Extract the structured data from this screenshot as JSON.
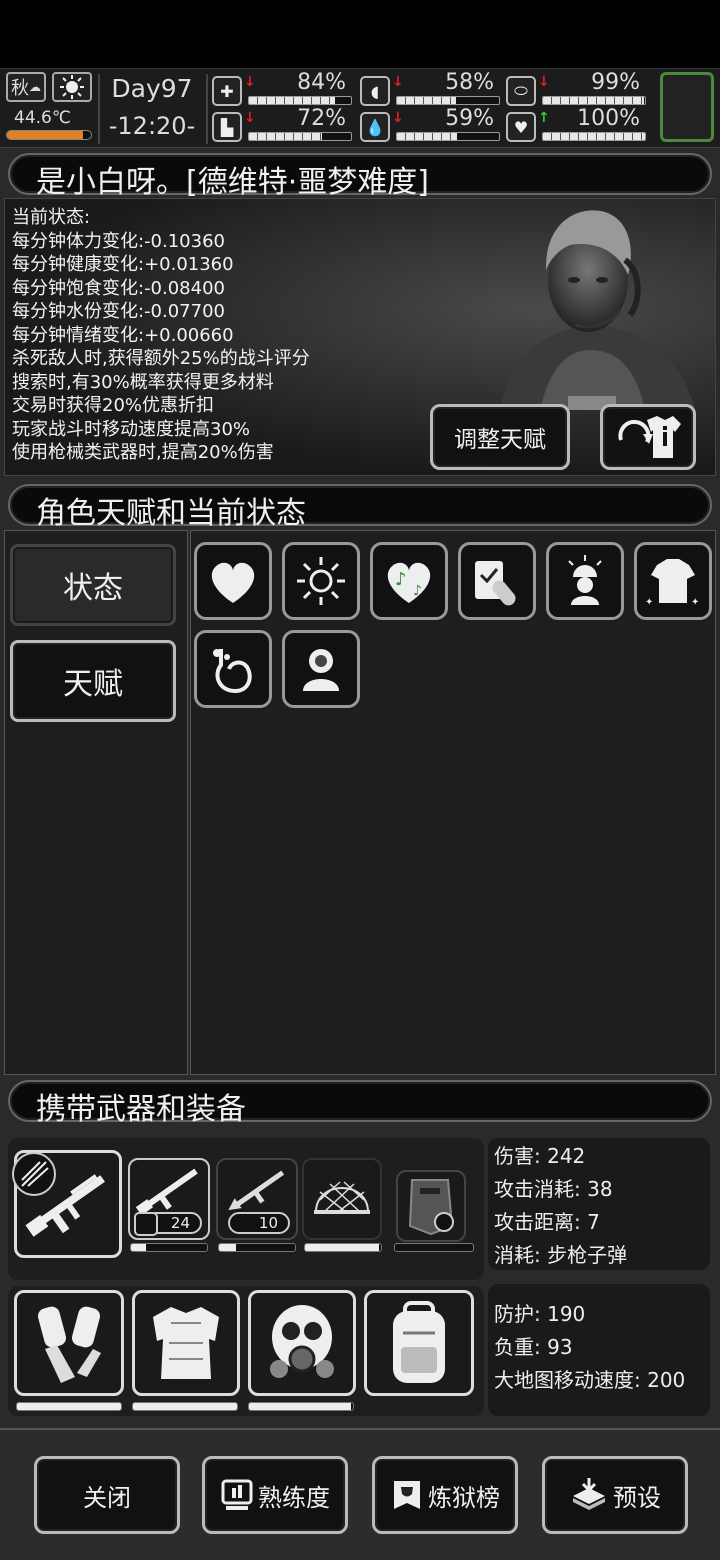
{
  "hud": {
    "season": "秋",
    "temperature": "44.6℃",
    "temperature_level": 0.9,
    "day": "Day97",
    "time": "-12:20-",
    "stats": [
      {
        "icon": "medkit-icon",
        "arrow": "down",
        "percent": "84%",
        "value": 0.84
      },
      {
        "icon": "stomach-icon",
        "arrow": "down",
        "percent": "58%",
        "value": 0.58
      },
      {
        "icon": "capsule-icon",
        "arrow": "down",
        "percent": "99%",
        "value": 0.99
      },
      {
        "icon": "boot-icon",
        "arrow": "down",
        "percent": "72%",
        "value": 0.72
      },
      {
        "icon": "water-drop-icon",
        "arrow": "down",
        "percent": "59%",
        "value": 0.59
      },
      {
        "icon": "heart-icon",
        "arrow": "up",
        "percent": "100%",
        "value": 1.0
      }
    ]
  },
  "player": {
    "title": "是小白呀。[德维特·噩梦难度]",
    "status_heading": "当前状态:",
    "status_lines": [
      "每分钟体力变化:-0.10360",
      "每分钟健康变化:+0.01360",
      "每分钟饱食变化:-0.08400",
      "每分钟水份变化:-0.07700",
      "每分钟情绪变化:+0.00660",
      "杀死敌人时,获得额外25%的战斗评分",
      "搜索时,有30%概率获得更多材料",
      "交易时获得20%优惠折扣",
      "玩家战斗时移动速度提高30%",
      "使用枪械类武器时,提高20%伤害"
    ],
    "adjust_talent_button": "调整天赋"
  },
  "talents": {
    "heading": "角色天赋和当前状态",
    "tabs": [
      "状态",
      "天赋"
    ],
    "icons": [
      "heart-icon",
      "sun-icon",
      "music-heart-icon",
      "medicine-icon",
      "alarm-person-icon",
      "shirt-icon",
      "stomach-icon",
      "sick-person-icon"
    ]
  },
  "equipment": {
    "heading": "携带武器和装备",
    "weapon_count_1": "24",
    "weapon_count_2": "10",
    "weapon_stats": [
      "伤害: 242",
      "攻击消耗: 38",
      "攻击距离: 7",
      "消耗: 步枪子弹"
    ],
    "armor_stats": [
      "防护: 190",
      "负重: 93",
      "大地图移动速度: 200"
    ]
  },
  "bottom_buttons": {
    "close": "关闭",
    "proficiency": "熟练度",
    "ranking": "炼狱榜",
    "preset": "预设"
  }
}
